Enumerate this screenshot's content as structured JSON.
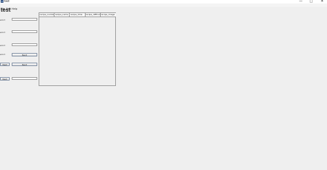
{
  "window": {
    "title": "test",
    "controls": {
      "minimize": "—",
      "maximize": "□",
      "close": "✕"
    }
  },
  "menu": [
    "File",
    "Edit",
    "Help"
  ],
  "heading": "test",
  "form": {
    "labels": [
      "word",
      "word",
      "word",
      "word"
    ],
    "buttons": {
      "row4_right": "Next",
      "row5_left": "Next",
      "row5_right": "Next",
      "row6_left": "Next"
    }
  },
  "table": {
    "columns": [
      "recipe_number",
      "recipe_name",
      "recipe_time",
      "recipe_difficulty",
      "recipe_image"
    ]
  },
  "colors": {
    "background": "#efefef",
    "accent": "#6a8fc0"
  },
  "icons": {
    "app": "app-icon"
  }
}
